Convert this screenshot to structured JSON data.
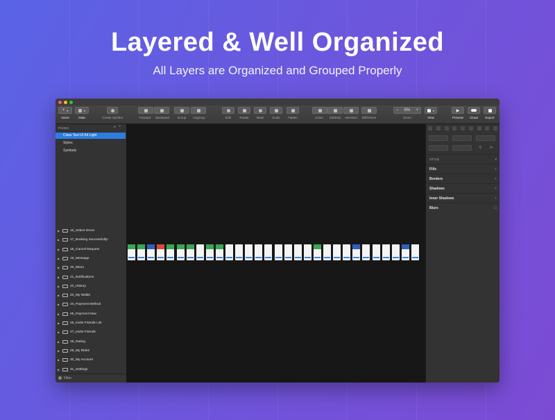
{
  "hero": {
    "title": "Layered & Well Organized",
    "subtitle": "All Layers are Organized and Grouped Properly"
  },
  "toolbar": {
    "insert": "Insert",
    "data": "Data",
    "create_symbol": "Create Symbol",
    "forward": "Forward",
    "backward": "Backward",
    "group": "Group",
    "ungroup": "Ungroup",
    "edit": "Edit",
    "rotate": "Rotate",
    "mask": "Mask",
    "scale": "Scale",
    "flatten": "Flatten",
    "union": "Union",
    "subtract": "Subtract",
    "intersect": "Intersect",
    "difference": "Difference",
    "zoom": "Zoom",
    "zoom_value": "6%",
    "view": "View",
    "preview": "Preview",
    "cloud": "Cloud",
    "export": "Export"
  },
  "pages": {
    "header": "PAGES",
    "items": [
      "Class Taxi UI Kit Light",
      "Styles",
      "Symbols"
    ]
  },
  "layers": [
    "16_Select Driver",
    "17_Booking Successfully!",
    "18_Cancel Request",
    "19_Message",
    "20_Menu",
    "21_Notifications",
    "22_History",
    "23_My Wallet",
    "24_Payment Method",
    "25_Payment New",
    "26_Invite Friends List",
    "27_Invite Friends",
    "28_Rating",
    "29_My Rides",
    "30_My Account",
    "31_Settings"
  ],
  "filter": "Filter",
  "inspector": {
    "style_header": "STYLE",
    "sections": [
      "Fills",
      "Borders",
      "Shadows",
      "Inner Shadows",
      "Blurs"
    ]
  },
  "colors": {
    "accent": "#2f7ce0",
    "green": "#3aa655",
    "close": "#ff5f57",
    "minimize": "#febc2e",
    "zoom": "#28c840"
  }
}
